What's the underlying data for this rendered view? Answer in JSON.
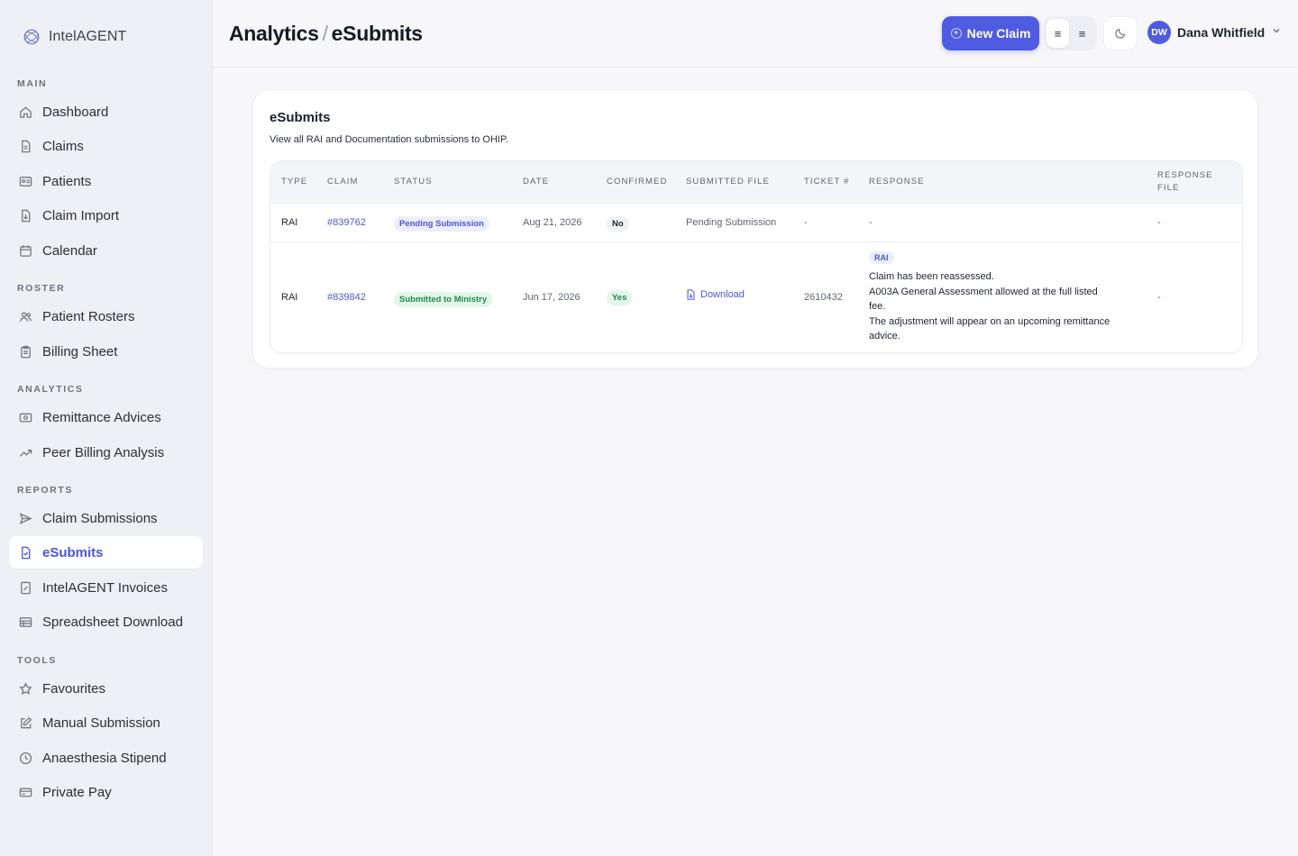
{
  "app": {
    "name": "IntelAGENT"
  },
  "sidebar": {
    "sections": [
      {
        "label": "MAIN",
        "items": [
          {
            "label": "Dashboard",
            "icon": "home-icon"
          },
          {
            "label": "Claims",
            "icon": "file-icon"
          },
          {
            "label": "Patients",
            "icon": "id-card-icon"
          },
          {
            "label": "Claim Import",
            "icon": "file-import-icon"
          },
          {
            "label": "Calendar",
            "icon": "calendar-icon"
          }
        ]
      },
      {
        "label": "ROSTER",
        "items": [
          {
            "label": "Patient Rosters",
            "icon": "users-icon"
          },
          {
            "label": "Billing Sheet",
            "icon": "clipboard-icon"
          }
        ]
      },
      {
        "label": "ANALYTICS",
        "items": [
          {
            "label": "Remittance Advices",
            "icon": "banknote-icon"
          },
          {
            "label": "Peer Billing Analysis",
            "icon": "trending-up-icon"
          }
        ]
      },
      {
        "label": "REPORTS",
        "items": [
          {
            "label": "Claim Submissions",
            "icon": "send-icon"
          },
          {
            "label": "eSubmits",
            "icon": "file-check-icon",
            "active": true
          },
          {
            "label": "IntelAGENT Invoices",
            "icon": "invoice-icon"
          },
          {
            "label": "Spreadsheet Download",
            "icon": "table-icon"
          }
        ]
      },
      {
        "label": "TOOLS",
        "items": [
          {
            "label": "Favourites",
            "icon": "star-icon"
          },
          {
            "label": "Manual Submission",
            "icon": "edit-icon"
          },
          {
            "label": "Anaesthesia Stipend",
            "icon": "clock-icon"
          },
          {
            "label": "Private Pay",
            "icon": "credit-card-icon"
          }
        ]
      }
    ]
  },
  "header": {
    "breadcrumb_parent": "Analytics",
    "breadcrumb_sep": "/",
    "breadcrumb_current": "eSubmits",
    "new_claim_label": "New Claim",
    "user_initials": "DW",
    "user_name": "Dana Whitfield"
  },
  "card": {
    "title": "eSubmits",
    "subtitle": "View all RAI and Documentation submissions to OHIP."
  },
  "table": {
    "columns": [
      "TYPE",
      "CLAIM",
      "STATUS",
      "DATE",
      "CONFIRMED",
      "SUBMITTED FILE",
      "TICKET #",
      "RESPONSE",
      "RESPONSE FILE"
    ],
    "rows": [
      {
        "type": "RAI",
        "claim": "#839762",
        "status": "Pending Submission",
        "date": "Aug 21, 2026",
        "confirmed": "No",
        "submitted_file": "Pending Submission",
        "ticket": "-",
        "response": "-",
        "response_file": "-"
      },
      {
        "type": "RAI",
        "claim": "#839842",
        "status": "Submitted to Ministry",
        "date": "Jun 17, 2026",
        "confirmed": "Yes",
        "submitted_file": "Download",
        "ticket": "2610432",
        "response_badge": "RAI",
        "response_lines": [
          "Claim has been reassessed.",
          "A003A General Assessment allowed at the full listed",
          "fee.",
          "The adjustment will appear on an upcoming remittance",
          "advice."
        ],
        "response_file": "-"
      }
    ]
  },
  "colors": {
    "accent": "#4f5be0",
    "sidebar_bg": "#eef0f5",
    "success": "#1f8a4c"
  }
}
